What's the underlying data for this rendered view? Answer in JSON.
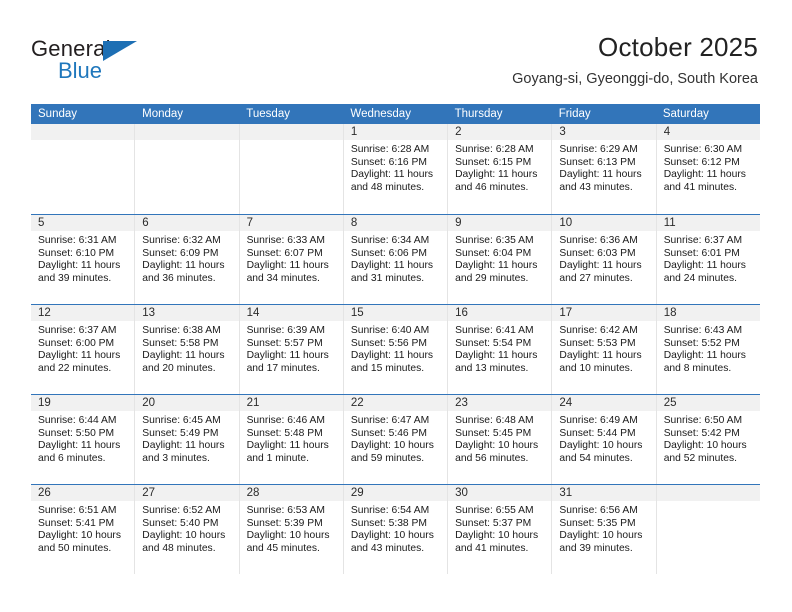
{
  "brand": {
    "name_part1": "General",
    "name_part2": "Blue"
  },
  "header": {
    "title": "October 2025",
    "subtitle": "Goyang-si, Gyeonggi-do, South Korea"
  },
  "colors": {
    "header_blue": "#3275ba",
    "brand_blue": "#1f77bc",
    "daynum_bg": "#f1f1f1",
    "cell_border": "#e4e4e4"
  },
  "labels": {
    "sunrise": "Sunrise:",
    "sunset": "Sunset:",
    "daylight": "Daylight:"
  },
  "weekdays": [
    "Sunday",
    "Monday",
    "Tuesday",
    "Wednesday",
    "Thursday",
    "Friday",
    "Saturday"
  ],
  "weeks": [
    [
      {
        "day": "",
        "sunrise": "",
        "sunset": "",
        "daylight_line1": "",
        "daylight_line2": ""
      },
      {
        "day": "",
        "sunrise": "",
        "sunset": "",
        "daylight_line1": "",
        "daylight_line2": ""
      },
      {
        "day": "",
        "sunrise": "",
        "sunset": "",
        "daylight_line1": "",
        "daylight_line2": ""
      },
      {
        "day": "1",
        "sunrise": "Sunrise: 6:28 AM",
        "sunset": "Sunset: 6:16 PM",
        "daylight_line1": "Daylight: 11 hours",
        "daylight_line2": "and 48 minutes."
      },
      {
        "day": "2",
        "sunrise": "Sunrise: 6:28 AM",
        "sunset": "Sunset: 6:15 PM",
        "daylight_line1": "Daylight: 11 hours",
        "daylight_line2": "and 46 minutes."
      },
      {
        "day": "3",
        "sunrise": "Sunrise: 6:29 AM",
        "sunset": "Sunset: 6:13 PM",
        "daylight_line1": "Daylight: 11 hours",
        "daylight_line2": "and 43 minutes."
      },
      {
        "day": "4",
        "sunrise": "Sunrise: 6:30 AM",
        "sunset": "Sunset: 6:12 PM",
        "daylight_line1": "Daylight: 11 hours",
        "daylight_line2": "and 41 minutes."
      }
    ],
    [
      {
        "day": "5",
        "sunrise": "Sunrise: 6:31 AM",
        "sunset": "Sunset: 6:10 PM",
        "daylight_line1": "Daylight: 11 hours",
        "daylight_line2": "and 39 minutes."
      },
      {
        "day": "6",
        "sunrise": "Sunrise: 6:32 AM",
        "sunset": "Sunset: 6:09 PM",
        "daylight_line1": "Daylight: 11 hours",
        "daylight_line2": "and 36 minutes."
      },
      {
        "day": "7",
        "sunrise": "Sunrise: 6:33 AM",
        "sunset": "Sunset: 6:07 PM",
        "daylight_line1": "Daylight: 11 hours",
        "daylight_line2": "and 34 minutes."
      },
      {
        "day": "8",
        "sunrise": "Sunrise: 6:34 AM",
        "sunset": "Sunset: 6:06 PM",
        "daylight_line1": "Daylight: 11 hours",
        "daylight_line2": "and 31 minutes."
      },
      {
        "day": "9",
        "sunrise": "Sunrise: 6:35 AM",
        "sunset": "Sunset: 6:04 PM",
        "daylight_line1": "Daylight: 11 hours",
        "daylight_line2": "and 29 minutes."
      },
      {
        "day": "10",
        "sunrise": "Sunrise: 6:36 AM",
        "sunset": "Sunset: 6:03 PM",
        "daylight_line1": "Daylight: 11 hours",
        "daylight_line2": "and 27 minutes."
      },
      {
        "day": "11",
        "sunrise": "Sunrise: 6:37 AM",
        "sunset": "Sunset: 6:01 PM",
        "daylight_line1": "Daylight: 11 hours",
        "daylight_line2": "and 24 minutes."
      }
    ],
    [
      {
        "day": "12",
        "sunrise": "Sunrise: 6:37 AM",
        "sunset": "Sunset: 6:00 PM",
        "daylight_line1": "Daylight: 11 hours",
        "daylight_line2": "and 22 minutes."
      },
      {
        "day": "13",
        "sunrise": "Sunrise: 6:38 AM",
        "sunset": "Sunset: 5:58 PM",
        "daylight_line1": "Daylight: 11 hours",
        "daylight_line2": "and 20 minutes."
      },
      {
        "day": "14",
        "sunrise": "Sunrise: 6:39 AM",
        "sunset": "Sunset: 5:57 PM",
        "daylight_line1": "Daylight: 11 hours",
        "daylight_line2": "and 17 minutes."
      },
      {
        "day": "15",
        "sunrise": "Sunrise: 6:40 AM",
        "sunset": "Sunset: 5:56 PM",
        "daylight_line1": "Daylight: 11 hours",
        "daylight_line2": "and 15 minutes."
      },
      {
        "day": "16",
        "sunrise": "Sunrise: 6:41 AM",
        "sunset": "Sunset: 5:54 PM",
        "daylight_line1": "Daylight: 11 hours",
        "daylight_line2": "and 13 minutes."
      },
      {
        "day": "17",
        "sunrise": "Sunrise: 6:42 AM",
        "sunset": "Sunset: 5:53 PM",
        "daylight_line1": "Daylight: 11 hours",
        "daylight_line2": "and 10 minutes."
      },
      {
        "day": "18",
        "sunrise": "Sunrise: 6:43 AM",
        "sunset": "Sunset: 5:52 PM",
        "daylight_line1": "Daylight: 11 hours",
        "daylight_line2": "and 8 minutes."
      }
    ],
    [
      {
        "day": "19",
        "sunrise": "Sunrise: 6:44 AM",
        "sunset": "Sunset: 5:50 PM",
        "daylight_line1": "Daylight: 11 hours",
        "daylight_line2": "and 6 minutes."
      },
      {
        "day": "20",
        "sunrise": "Sunrise: 6:45 AM",
        "sunset": "Sunset: 5:49 PM",
        "daylight_line1": "Daylight: 11 hours",
        "daylight_line2": "and 3 minutes."
      },
      {
        "day": "21",
        "sunrise": "Sunrise: 6:46 AM",
        "sunset": "Sunset: 5:48 PM",
        "daylight_line1": "Daylight: 11 hours",
        "daylight_line2": "and 1 minute."
      },
      {
        "day": "22",
        "sunrise": "Sunrise: 6:47 AM",
        "sunset": "Sunset: 5:46 PM",
        "daylight_line1": "Daylight: 10 hours",
        "daylight_line2": "and 59 minutes."
      },
      {
        "day": "23",
        "sunrise": "Sunrise: 6:48 AM",
        "sunset": "Sunset: 5:45 PM",
        "daylight_line1": "Daylight: 10 hours",
        "daylight_line2": "and 56 minutes."
      },
      {
        "day": "24",
        "sunrise": "Sunrise: 6:49 AM",
        "sunset": "Sunset: 5:44 PM",
        "daylight_line1": "Daylight: 10 hours",
        "daylight_line2": "and 54 minutes."
      },
      {
        "day": "25",
        "sunrise": "Sunrise: 6:50 AM",
        "sunset": "Sunset: 5:42 PM",
        "daylight_line1": "Daylight: 10 hours",
        "daylight_line2": "and 52 minutes."
      }
    ],
    [
      {
        "day": "26",
        "sunrise": "Sunrise: 6:51 AM",
        "sunset": "Sunset: 5:41 PM",
        "daylight_line1": "Daylight: 10 hours",
        "daylight_line2": "and 50 minutes."
      },
      {
        "day": "27",
        "sunrise": "Sunrise: 6:52 AM",
        "sunset": "Sunset: 5:40 PM",
        "daylight_line1": "Daylight: 10 hours",
        "daylight_line2": "and 48 minutes."
      },
      {
        "day": "28",
        "sunrise": "Sunrise: 6:53 AM",
        "sunset": "Sunset: 5:39 PM",
        "daylight_line1": "Daylight: 10 hours",
        "daylight_line2": "and 45 minutes."
      },
      {
        "day": "29",
        "sunrise": "Sunrise: 6:54 AM",
        "sunset": "Sunset: 5:38 PM",
        "daylight_line1": "Daylight: 10 hours",
        "daylight_line2": "and 43 minutes."
      },
      {
        "day": "30",
        "sunrise": "Sunrise: 6:55 AM",
        "sunset": "Sunset: 5:37 PM",
        "daylight_line1": "Daylight: 10 hours",
        "daylight_line2": "and 41 minutes."
      },
      {
        "day": "31",
        "sunrise": "Sunrise: 6:56 AM",
        "sunset": "Sunset: 5:35 PM",
        "daylight_line1": "Daylight: 10 hours",
        "daylight_line2": "and 39 minutes."
      },
      {
        "day": "",
        "sunrise": "",
        "sunset": "",
        "daylight_line1": "",
        "daylight_line2": ""
      }
    ]
  ]
}
